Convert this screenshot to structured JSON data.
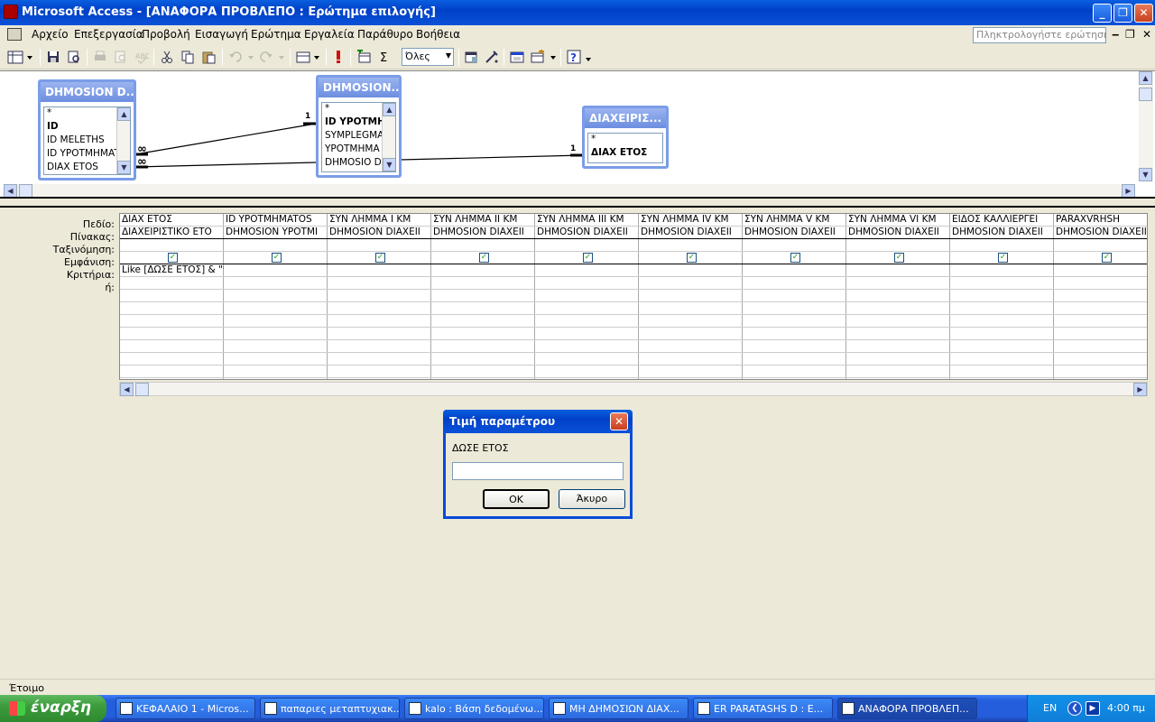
{
  "window": {
    "title": "Microsoft Access - [ΑΝΑΦΟΡΑ ΠΡΟΒΛΕΠΟ : Ερώτημα επιλογής]"
  },
  "menu": {
    "items": [
      "Αρχείο",
      "Επεξεργασία",
      "Προβολή",
      "Εισαγωγή",
      "Ερώτημα",
      "Εργαλεία",
      "Παράθυρο",
      "Βοήθεια"
    ],
    "help_placeholder": "Πληκτρολογήστε ερώτηση"
  },
  "toolbar": {
    "combo_value": "Όλες"
  },
  "tables": [
    {
      "title": "DHMOSION D...",
      "fields": [
        {
          "name": "*",
          "key": false
        },
        {
          "name": "ID",
          "key": true
        },
        {
          "name": "ID MELETHS",
          "key": false
        },
        {
          "name": "ID YPOTMHMATO",
          "key": false
        },
        {
          "name": "DIAX ETOS",
          "key": false
        }
      ]
    },
    {
      "title": "DHMOSION...",
      "fields": [
        {
          "name": "*",
          "key": false
        },
        {
          "name": "ID YPOTMHMA",
          "key": true
        },
        {
          "name": "SYMPLEGMA",
          "key": false
        },
        {
          "name": "YPOTMHMA",
          "key": false
        },
        {
          "name": "DHMOSIO DA",
          "key": false
        }
      ]
    },
    {
      "title": "ΔΙΑΧΕΙΡΙΣ...",
      "fields": [
        {
          "name": "*",
          "key": false
        },
        {
          "name": "ΔΙΑΧ ΕΤΟΣ",
          "key": true
        }
      ]
    }
  ],
  "relationships": {
    "one": "1",
    "many": "∞"
  },
  "grid": {
    "row_labels": [
      "Πεδίο:",
      "Πίνακας:",
      "Ταξινόμηση:",
      "Εμφάνιση:",
      "Κριτήρια:",
      "ή:"
    ],
    "columns": [
      {
        "field": "ΔΙΑΧ ΕΤΟΣ",
        "table": "ΔΙΑΧΕΙΡΙΣΤΙΚΟ ΕΤΟ",
        "criteria": "Like [ΔΩΣΕ ΕΤΟΣ] & \"*\""
      },
      {
        "field": "ID YPOTMHMATOS",
        "table": "DHMOSION YPOTMI",
        "criteria": ""
      },
      {
        "field": "ΣΥΝ ΛΗΜΜΑ I KM",
        "table": "DHMOSION DIAXEII",
        "criteria": ""
      },
      {
        "field": "ΣΥΝ ΛΗΜΜΑ II KM",
        "table": "DHMOSION DIAXEII",
        "criteria": ""
      },
      {
        "field": "ΣΥΝ ΛΗΜΜΑ III KM",
        "table": "DHMOSION DIAXEII",
        "criteria": ""
      },
      {
        "field": "ΣΥΝ ΛΗΜΜΑ IV KM",
        "table": "DHMOSION DIAXEII",
        "criteria": ""
      },
      {
        "field": "ΣΥΝ ΛΗΜΜΑ V KM",
        "table": "DHMOSION DIAXEII",
        "criteria": ""
      },
      {
        "field": "ΣΥΝ ΛΗΜΜΑ VI KM",
        "table": "DHMOSION DIAXEII",
        "criteria": ""
      },
      {
        "field": "ΕΙΔΟΣ ΚΑΛΛΙΕΡΓΕΙ",
        "table": "DHMOSION DIAXEII",
        "criteria": ""
      },
      {
        "field": "PARAXVRHSH",
        "table": "DHMOSION DIAXEII",
        "criteria": ""
      }
    ]
  },
  "dialog": {
    "title": "Τιμή παραμέτρου",
    "prompt": "ΔΩΣΕ ΕΤΟΣ",
    "input_value": "",
    "ok_label": "OK",
    "cancel_label": "Άκυρο"
  },
  "status": {
    "text": "Έτοιμο"
  },
  "taskbar": {
    "start_label": "έναρξη",
    "tasks": [
      {
        "label": "ΚΕΦΑΛΑΙΟ 1 - Micros...",
        "active": false
      },
      {
        "label": "παπαριες μεταπτυχιακ...",
        "active": false
      },
      {
        "label": "kalo : Βάση δεδομένω...",
        "active": false
      },
      {
        "label": "ΜΗ ΔΗΜΟΣΙΩΝ ΔΙΑΧ...",
        "active": false
      },
      {
        "label": "ER PARATASHS D : E...",
        "active": false
      },
      {
        "label": "ΑΝΑΦΟΡΑ ΠΡΟΒΛΕΠ...",
        "active": true
      }
    ],
    "lang": "EN",
    "clock": "4:00 πμ"
  },
  "colors": {
    "titlebar": "#0a52d8",
    "table_header": "#7b9de8",
    "taskbar": "#245edc",
    "start": "#3c9c3c"
  }
}
